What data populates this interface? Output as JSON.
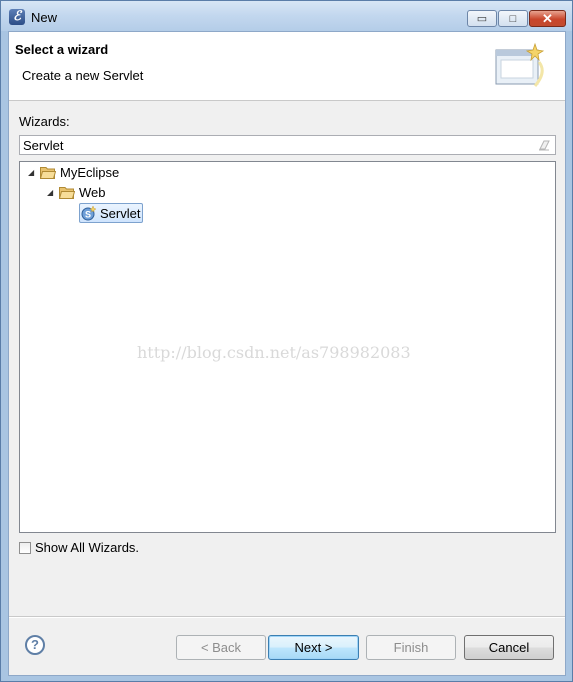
{
  "window": {
    "title": "New",
    "minimize_glyph": "▭",
    "maximize_glyph": "□",
    "close_glyph": "✕"
  },
  "header": {
    "title": "Select a wizard",
    "description": "Create a new Servlet"
  },
  "wizards_label": "Wizards:",
  "filter": {
    "value": "Servlet"
  },
  "tree": [
    {
      "label": "MyEclipse",
      "icon": "folder-open-icon",
      "expanded": true
    },
    {
      "label": "Web",
      "icon": "folder-open-icon",
      "expanded": true
    },
    {
      "label": "Servlet",
      "icon": "servlet-icon",
      "selected": true
    }
  ],
  "watermark": "http://blog.csdn.net/as798982083",
  "show_all": {
    "label": "Show All Wizards.",
    "checked": false
  },
  "buttons": {
    "back": "< Back",
    "next": "Next >",
    "finish": "Finish",
    "cancel": "Cancel",
    "help": "?"
  },
  "colors": {
    "selection": "#cfe4fd",
    "title_bar": "#c2d7ee",
    "close": "#c9462c"
  }
}
